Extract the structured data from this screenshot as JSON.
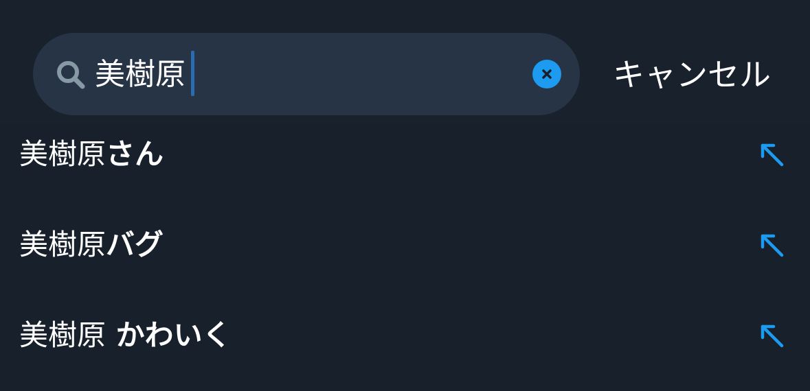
{
  "search": {
    "query": "美樹原",
    "cancel_label": "キャンセル"
  },
  "suggestions": [
    {
      "typed": "美樹原",
      "completion": "さん"
    },
    {
      "typed": "美樹原",
      "completion": "バグ"
    },
    {
      "typed": "美樹原",
      "completion": " かわいく"
    }
  ],
  "colors": {
    "background": "#17202b",
    "search_field": "#273445",
    "accent": "#1d9bf0",
    "icon_gray": "#8899a6"
  },
  "icons": {
    "search": "search-icon",
    "clear": "clear-x-icon",
    "suggestion": "arrow-up-left-icon"
  }
}
